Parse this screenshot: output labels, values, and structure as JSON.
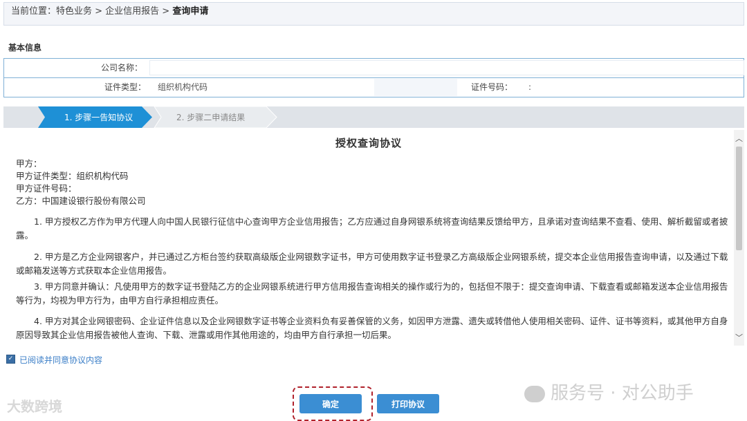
{
  "breadcrumb": {
    "prefix": "当前位置：特色业务 > 企业信用报告 > ",
    "current": "查询申请"
  },
  "section_title": "基本信息",
  "info": {
    "company_label": "公司名称：",
    "company_value": "",
    "doc_type_label": "证件类型：",
    "doc_type_value": "组织机构代码",
    "doc_no_label": "证件号码：",
    "doc_no_value": ":"
  },
  "steps": [
    {
      "label": "1. 步骤一告知协议",
      "active": true
    },
    {
      "label": "2. 步骤二申请结果",
      "active": false
    }
  ],
  "agreement": {
    "title": "授权查询协议",
    "party_a": "甲方：",
    "party_a_type": "甲方证件类型：组织机构代码",
    "party_a_no": "甲方证件号码：",
    "party_b": "乙方：中国建设银行股份有限公司",
    "paragraphs": [
      "1. 甲方授权乙方作为甲方代理人向中国人民银行征信中心查询甲方企业信用报告；乙方应通过自身网银系统将查询结果反馈给甲方，且承诺对查询结果不查看、使用、解析截留或者披露。",
      "2. 甲方是乙方企业网银客户，并已通过乙方柜台签约获取高级版企业网银数字证书，甲方可使用数字证书登录乙方高级版企业网银系统，提交本企业信用报告查询申请，以及通过下载或邮箱发送等方式获取本企业信用报告。",
      "3.  甲方同意并确认：凡使用甲方的数字证书登陆乙方的企业网银系统进行甲方信用报告查询相关的操作或行为的，包括但不限于：提交查询申请、下载查看或邮箱发送本企业信用报告等行为，均视为甲方行为，由甲方自行承担相应责任。",
      "4. 甲方对其企业网银密码、企业证件信息以及企业网银数字证书等企业资料负有妥善保管的义务，如因甲方泄露、遗失或转借他人使用相关密码、证件、证书等资料，或其他甲方自身原因导致其企业信用报告被他人查询、下载、泄露或用作其他用途的，均由甲方自行承担一切后果。"
    ]
  },
  "agree_text": "已阅读并同意协议内容",
  "buttons": {
    "confirm": "确定",
    "print": "打印协议"
  },
  "watermarks": {
    "left": "大数跨境",
    "right": "服务号 · 对公助手"
  },
  "colors": {
    "accent": "#3b8ed3",
    "step_active": "#1e90d6",
    "highlight_border": "#b0212b"
  }
}
